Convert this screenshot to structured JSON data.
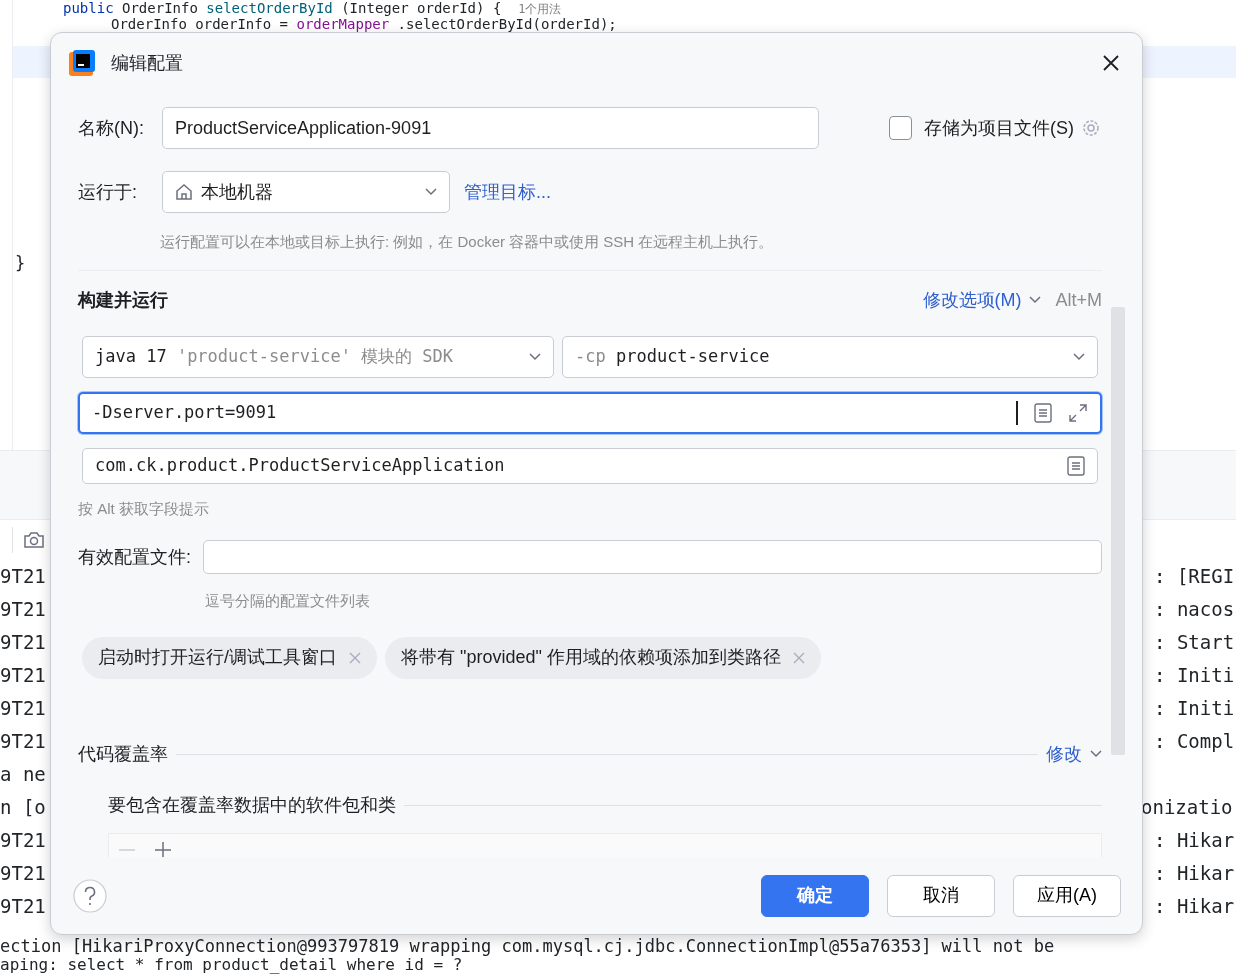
{
  "editor": {
    "lines": [
      {
        "tokens": [
          {
            "text": "public",
            "kind": "keyword"
          },
          {
            "text": "OrderInfo",
            "kind": "plain"
          },
          {
            "text": "selectOrderById",
            "kind": "method"
          },
          {
            "text": "(Integer orderId) {",
            "kind": "plain"
          }
        ],
        "hint": "1个用法"
      },
      {
        "tokens": [
          {
            "text": "OrderInfo orderInfo =",
            "kind": "plain"
          },
          {
            "text": "orderMapper",
            "kind": "field"
          },
          {
            "text": ".selectOrderById(orderId);",
            "kind": "plain"
          }
        ]
      },
      {
        "tokens": [
          {
            "text": "}",
            "kind": "plain"
          }
        ]
      }
    ]
  },
  "console": {
    "rows": [
      {
        "left": "9T21",
        "right": ": [REGI"
      },
      {
        "left": "9T21",
        "right": ": nacos"
      },
      {
        "left": "9T21",
        "right": ": Start"
      },
      {
        "left": "9T21",
        "right": ": Initi"
      },
      {
        "left": "9T21",
        "right": ": Initi"
      },
      {
        "left": "9T21",
        "right": ": Compl"
      },
      {
        "left": "a ne"
      },
      {
        "left": "n [o",
        "right": "onizatio"
      },
      {
        "left": "9T21",
        "right": ": Hikar"
      },
      {
        "left": "9T21",
        "right": ": Hikar"
      },
      {
        "left": "9T21",
        "right": ": Hikar"
      }
    ],
    "tail": [
      "ection [HikariProxyConnection@993797819 wrapping com.mysql.cj.jdbc.ConnectionImpl@55a76353] will not be",
      "aping: select * from product_detail where id = ?"
    ]
  },
  "dialog": {
    "title": "编辑配置",
    "name": {
      "label": "名称(N):",
      "value": "ProductServiceApplication-9091"
    },
    "store": {
      "label": "存储为项目文件(S)",
      "checked": false
    },
    "run_on": {
      "label": "运行于:",
      "value": "本地机器",
      "link": "管理目标...",
      "hint": "运行配置可以在本地或目标上执行: 例如，在 Docker 容器中或使用 SSH 在远程主机上执行。"
    },
    "build": {
      "title": "构建并运行",
      "modify": "修改选项(M)",
      "shortcut": "Alt+M",
      "sdk": {
        "version": "java 17",
        "module": "'product-service'",
        "suffix": "模块的 SDK"
      },
      "classpath": {
        "prefix": "-cp",
        "value": "product-service"
      },
      "vm_options": {
        "value": "-Dserver.port=9091",
        "focused": true
      },
      "main_class": {
        "value": "com.ck.product.ProductServiceApplication",
        "focused": false
      },
      "hint": "按 Alt 获取字段提示"
    },
    "profiles": {
      "label": "有效配置文件:",
      "hint": "逗号分隔的配置文件列表"
    },
    "chips": [
      "启动时打开运行/调试工具窗口",
      "将带有 \"provided\" 作用域的依赖项添加到类路径"
    ],
    "coverage": {
      "title": "代码覆盖率",
      "modify": "修改",
      "packages": "要包含在覆盖率数据中的软件包和类"
    },
    "buttons": [
      {
        "label": "确定",
        "kind": "primary"
      },
      {
        "label": "取消",
        "kind": "default"
      },
      {
        "label": "应用(A)",
        "kind": "default"
      }
    ]
  }
}
